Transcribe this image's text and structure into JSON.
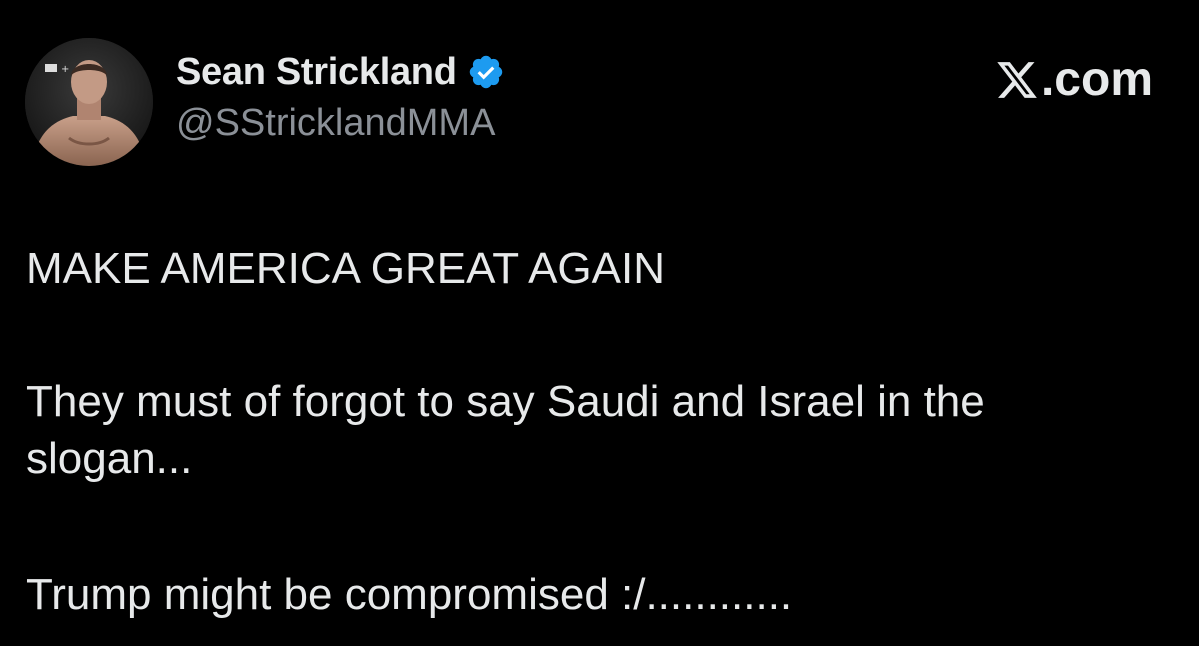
{
  "author": {
    "display_name": "Sean Strickland",
    "handle": "@SStricklandMMA",
    "verified": true,
    "verified_icon": "verified-badge-icon",
    "verified_color": "#1d9bf0"
  },
  "brand": {
    "label": ".com",
    "icon": "x-logo-icon"
  },
  "tweet": {
    "paragraphs": [
      "MAKE AMERICA GREAT AGAIN",
      "They must of forgot to say Saudi and Israel in the slogan...",
      "Trump might be compromised :/............"
    ]
  },
  "colors": {
    "background": "#000000",
    "text": "#e7e9ea",
    "secondary_text": "#8b9097"
  }
}
